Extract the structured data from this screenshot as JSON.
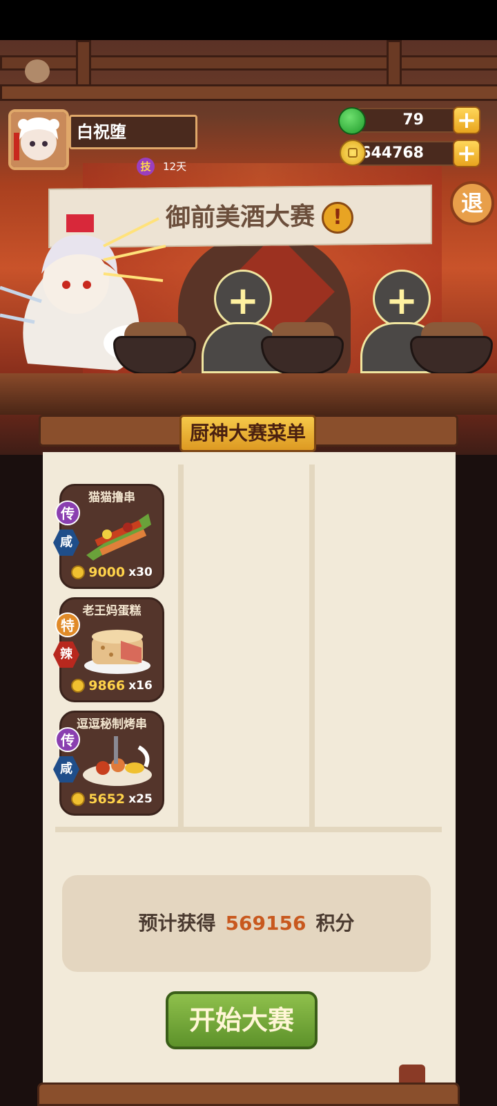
{
  "player": {
    "name": "白祝堕",
    "skill_badge": "技",
    "days": "12天"
  },
  "currency": {
    "jade": "79",
    "coins": "644768",
    "add_symbol": "+"
  },
  "exit_label": "退",
  "event": {
    "title": "御前美酒大赛",
    "alert_symbol": "!"
  },
  "slots": [
    {
      "symbol": "+"
    },
    {
      "symbol": "+"
    }
  ],
  "menu": {
    "title": "厨神大赛菜单",
    "dishes": [
      {
        "name": "猫猫撸串",
        "rarity": "传",
        "flavor": "咸",
        "price": "9000",
        "qty": "x30",
        "rarity_color": "#8a3fb0",
        "flavor_color": "#1f4e8a"
      },
      {
        "name": "老王妈蛋糕",
        "rarity": "特",
        "flavor": "辣",
        "price": "9866",
        "qty": "x16",
        "rarity_color": "#e08a28",
        "flavor_color": "#b8281e"
      },
      {
        "name": "逗逗秘制烤串",
        "rarity": "传",
        "flavor": "咸",
        "price": "5652",
        "qty": "x25",
        "rarity_color": "#8a3fb0",
        "flavor_color": "#1f4e8a"
      }
    ]
  },
  "estimate": {
    "prefix": "预计获得",
    "value": "569156",
    "suffix": "积分"
  },
  "start_button": "开始大赛"
}
